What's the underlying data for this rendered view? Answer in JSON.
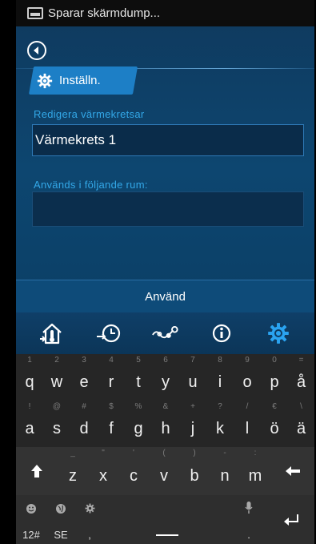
{
  "status_bar": {
    "notification": "Sparar skärmdump..."
  },
  "header": {
    "tab_label": "Inställn."
  },
  "form": {
    "circuit_label": "Redigera värmekretsar",
    "circuit_value": "Värmekrets 1",
    "rooms_label": "Används i följande rum:",
    "rooms_value": ""
  },
  "apply_label": "Använd",
  "nav": [
    "home-temperature-icon",
    "schedule-icon",
    "graph-icon",
    "info-icon",
    "settings-icon"
  ],
  "colors": {
    "accent": "#1d7fc6",
    "label": "#33a8e8",
    "active_icon": "#2aa3f0"
  },
  "keyboard": {
    "row1": [
      {
        "k": "q",
        "a": "1"
      },
      {
        "k": "w",
        "a": "2"
      },
      {
        "k": "e",
        "a": "3"
      },
      {
        "k": "r",
        "a": "4"
      },
      {
        "k": "t",
        "a": "5"
      },
      {
        "k": "y",
        "a": "6"
      },
      {
        "k": "u",
        "a": "7"
      },
      {
        "k": "i",
        "a": "8"
      },
      {
        "k": "o",
        "a": "9"
      },
      {
        "k": "p",
        "a": "0"
      },
      {
        "k": "å",
        "a": "="
      }
    ],
    "row2": [
      {
        "k": "a",
        "a": "!"
      },
      {
        "k": "s",
        "a": "@"
      },
      {
        "k": "d",
        "a": "#"
      },
      {
        "k": "f",
        "a": "$"
      },
      {
        "k": "g",
        "a": "%"
      },
      {
        "k": "h",
        "a": "&"
      },
      {
        "k": "j",
        "a": "+"
      },
      {
        "k": "k",
        "a": "?"
      },
      {
        "k": "l",
        "a": "/"
      },
      {
        "k": "ö",
        "a": "€"
      },
      {
        "k": "ä",
        "a": "\\"
      }
    ],
    "row3": [
      {
        "k": "z",
        "a": "_"
      },
      {
        "k": "x",
        "a": "\""
      },
      {
        "k": "c",
        "a": "'"
      },
      {
        "k": "v",
        "a": "("
      },
      {
        "k": "b",
        "a": ")"
      },
      {
        "k": "n",
        "a": "-"
      },
      {
        "k": "m",
        "a": ":"
      }
    ],
    "row4": {
      "symbols": "12#",
      "language": "SE",
      "comma": ",",
      "period": "."
    }
  }
}
